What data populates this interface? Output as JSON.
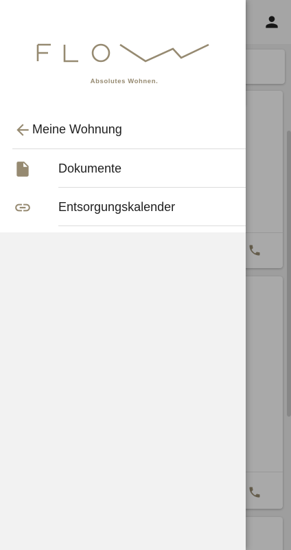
{
  "app": {
    "accent_color": "#968a71"
  },
  "drawer": {
    "logo": {
      "wordmark": "FLOW",
      "tagline": "Absolutes Wohnen."
    },
    "back_item": {
      "label": "Meine Wohnung",
      "icon": "arrow-back-icon"
    },
    "items": [
      {
        "label": "Dokumente",
        "icon": "document-icon"
      },
      {
        "label": "Entsorgungskalender",
        "icon": "link-icon"
      }
    ]
  },
  "background": {
    "account_icon": "person-icon",
    "card_action_icon": "phone-icon"
  }
}
